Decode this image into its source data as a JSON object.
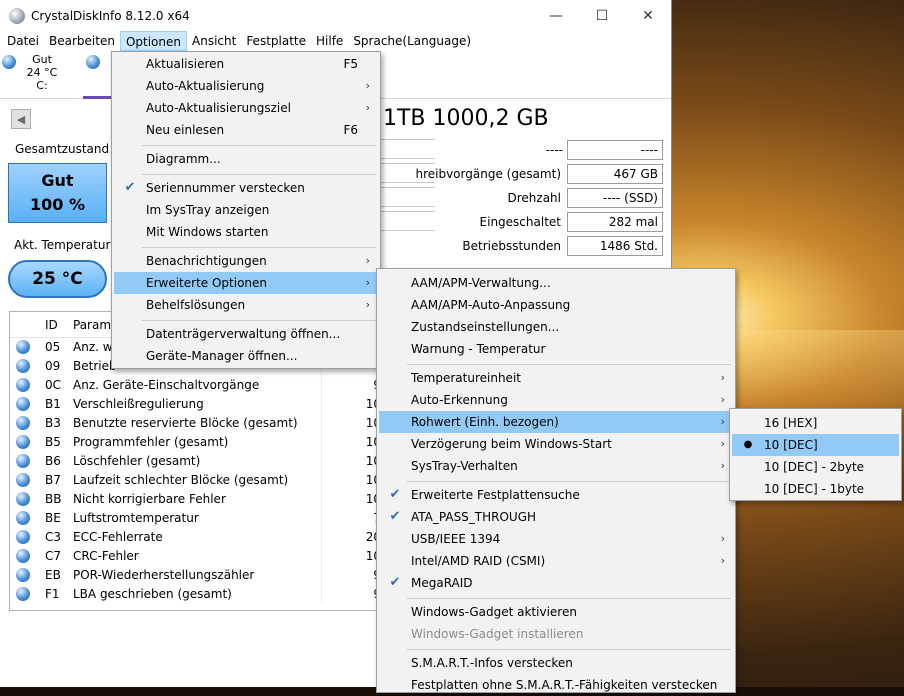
{
  "window": {
    "title": "CrystalDiskInfo 8.12.0 x64",
    "controls": {
      "minimize": "—",
      "maximize": "☐",
      "close": "✕"
    }
  },
  "menubar": [
    "Datei",
    "Bearbeiten",
    "Optionen",
    "Ansicht",
    "Festplatte",
    "Hilfe",
    "Sprache(Language)"
  ],
  "disk": {
    "status": "Gut",
    "temp": "24 °C",
    "letter": "C:"
  },
  "model": "1TB 1000,2 GB",
  "info": [
    {
      "key": "",
      "value": "----",
      "extra": "----"
    },
    {
      "key": "hreibvorgänge (gesamt)",
      "value": "467 GB"
    },
    {
      "key": "Drehzahl",
      "value": "---- (SSD)"
    },
    {
      "key": "Eingeschaltet",
      "value": "282 mal"
    },
    {
      "key": "Betriebsstunden",
      "value": "1486 Std."
    }
  ],
  "health": {
    "label": "Gesamtzustand",
    "status": "Gut",
    "percent": "100 %"
  },
  "temperature": {
    "label": "Akt. Temperatur",
    "value": "25 °C"
  },
  "table": {
    "col_id": "ID",
    "col_name": "Parame",
    "rows": [
      {
        "id": "05",
        "name": "Anz. wi",
        "val": ""
      },
      {
        "id": "09",
        "name": "Betrieb",
        "val": ""
      },
      {
        "id": "0C",
        "name": "Anz. Geräte-Einschaltvorgänge",
        "val": "9"
      },
      {
        "id": "B1",
        "name": "Verschleißregulierung",
        "val": "10"
      },
      {
        "id": "B3",
        "name": "Benutzte reservierte Blöcke (gesamt)",
        "val": "10"
      },
      {
        "id": "B5",
        "name": "Programmfehler (gesamt)",
        "val": "10"
      },
      {
        "id": "B6",
        "name": "Löschfehler (gesamt)",
        "val": "10"
      },
      {
        "id": "B7",
        "name": "Laufzeit schlechter Blöcke (gesamt)",
        "val": "10"
      },
      {
        "id": "BB",
        "name": "Nicht korrigierbare Fehler",
        "val": "10"
      },
      {
        "id": "BE",
        "name": "Luftstromtemperatur",
        "val": "7"
      },
      {
        "id": "C3",
        "name": "ECC-Fehlerrate",
        "val": "20"
      },
      {
        "id": "C7",
        "name": "CRC-Fehler",
        "val": "10"
      },
      {
        "id": "EB",
        "name": "POR-Wiederherstellungszähler",
        "val": "9"
      },
      {
        "id": "F1",
        "name": "LBA geschrieben (gesamt)",
        "val": "9"
      }
    ]
  },
  "options_menu": [
    {
      "label": "Aktualisieren",
      "shortcut": "F5"
    },
    {
      "label": "Auto-Aktualisierung",
      "arrow": "›"
    },
    {
      "label": "Auto-Aktualisierungsziel",
      "arrow": "›"
    },
    {
      "label": "Neu einlesen",
      "shortcut": "F6"
    },
    {
      "label": "Diagramm..."
    },
    {
      "label": "Seriennummer verstecken",
      "check": "✔"
    },
    {
      "label": "Im SysTray anzeigen"
    },
    {
      "label": "Mit Windows starten"
    },
    {
      "label": "Benachrichtigungen",
      "arrow": "›"
    },
    {
      "label": "Erweiterte Optionen",
      "arrow": "›"
    },
    {
      "label": "Behelfslösungen",
      "arrow": "›"
    },
    {
      "label": "Datenträgerverwaltung öffnen..."
    },
    {
      "label": "Geräte-Manager öffnen..."
    }
  ],
  "advanced_menu": [
    {
      "label": "AAM/APM-Verwaltung..."
    },
    {
      "label": "AAM/APM-Auto-Anpassung"
    },
    {
      "label": "Zustandseinstellungen..."
    },
    {
      "label": "Warnung - Temperatur"
    },
    {
      "label": "Temperatureinheit",
      "arrow": "›"
    },
    {
      "label": "Auto-Erkennung",
      "arrow": "›"
    },
    {
      "label": "Rohwert (Einh. bezogen)",
      "arrow": "›"
    },
    {
      "label": "Verzögerung beim Windows-Start",
      "arrow": "›"
    },
    {
      "label": "SysTray-Verhalten",
      "arrow": "›"
    },
    {
      "label": "Erweiterte Festplattensuche",
      "check": "✔"
    },
    {
      "label": "ATA_PASS_THROUGH",
      "check": "✔"
    },
    {
      "label": "USB/IEEE 1394",
      "arrow": "›"
    },
    {
      "label": "Intel/AMD RAID (CSMI)",
      "arrow": "›"
    },
    {
      "label": "MegaRAID",
      "check": "✔"
    },
    {
      "label": "Windows-Gadget aktivieren"
    },
    {
      "label": "Windows-Gadget installieren"
    },
    {
      "label": "S.M.A.R.T.-Infos verstecken"
    },
    {
      "label": "Festplatten ohne S.M.A.R.T.-Fähigkeiten verstecken"
    }
  ],
  "raw_menu": [
    {
      "label": "16 [HEX]"
    },
    {
      "label": "10 [DEC]",
      "bullet": "●"
    },
    {
      "label": "10 [DEC] - 2byte"
    },
    {
      "label": "10 [DEC] - 1byte"
    }
  ]
}
